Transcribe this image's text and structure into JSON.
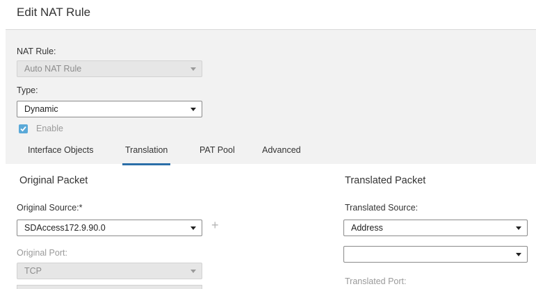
{
  "dialog": {
    "title": "Edit NAT Rule"
  },
  "nat_rule": {
    "label": "NAT Rule:",
    "value": "Auto NAT Rule"
  },
  "type": {
    "label": "Type:",
    "value": "Dynamic"
  },
  "enable": {
    "label": "Enable",
    "checked": true
  },
  "tabs": [
    {
      "label": "Interface Objects",
      "active": false
    },
    {
      "label": "Translation",
      "active": true
    },
    {
      "label": "PAT Pool",
      "active": false
    },
    {
      "label": "Advanced",
      "active": false
    }
  ],
  "original_packet": {
    "heading": "Original Packet",
    "source_label": "Original Source:*",
    "source_value": "SDAccess172.9.90.0",
    "add_symbol": "+",
    "port_label": "Original Port:",
    "port_value": "TCP"
  },
  "translated_packet": {
    "heading": "Translated Packet",
    "source_label": "Translated Source:",
    "source_value": "Address",
    "address_value": "",
    "port_label": "Translated Port:"
  },
  "colors": {
    "accent": "#2b6ea8",
    "checkbox": "#5aa9d8",
    "panel_bg": "#f2f2f2"
  }
}
